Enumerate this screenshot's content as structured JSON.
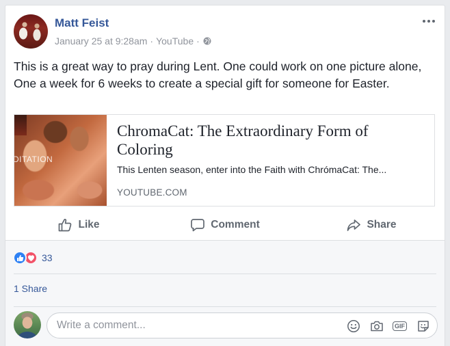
{
  "post": {
    "author": "Matt Feist",
    "date": "January 25 at 9:28am",
    "source": "YouTube",
    "separator": "·",
    "text": "This is a great way to pray during Lent. One could work on one picture alone, One a week for 6 weeks to create a special gift for someone for Easter."
  },
  "link": {
    "thumb_text": "DITATION",
    "title": "ChromaCat: The Extraordinary Form of Coloring",
    "description": "This Lenten season, enter into the Faith with ChrómaCat: The...",
    "domain": "YOUTUBE.COM"
  },
  "actions": {
    "like": "Like",
    "comment": "Comment",
    "share": "Share"
  },
  "reactions": {
    "count": "33",
    "types": [
      "like",
      "love"
    ]
  },
  "shares": "1 Share",
  "comment_box": {
    "placeholder": "Write a comment..."
  },
  "icons": {
    "globe": "globe-icon",
    "more": "more-options-icon",
    "emoji": "emoji-icon",
    "camera": "camera-icon",
    "gif_label": "GIF",
    "sticker": "sticker-icon"
  },
  "colors": {
    "link_blue": "#365899",
    "like_blue": "#2e81f4",
    "love_red": "#f25268",
    "secondary_text": "#90949c",
    "action_text": "#606770"
  }
}
